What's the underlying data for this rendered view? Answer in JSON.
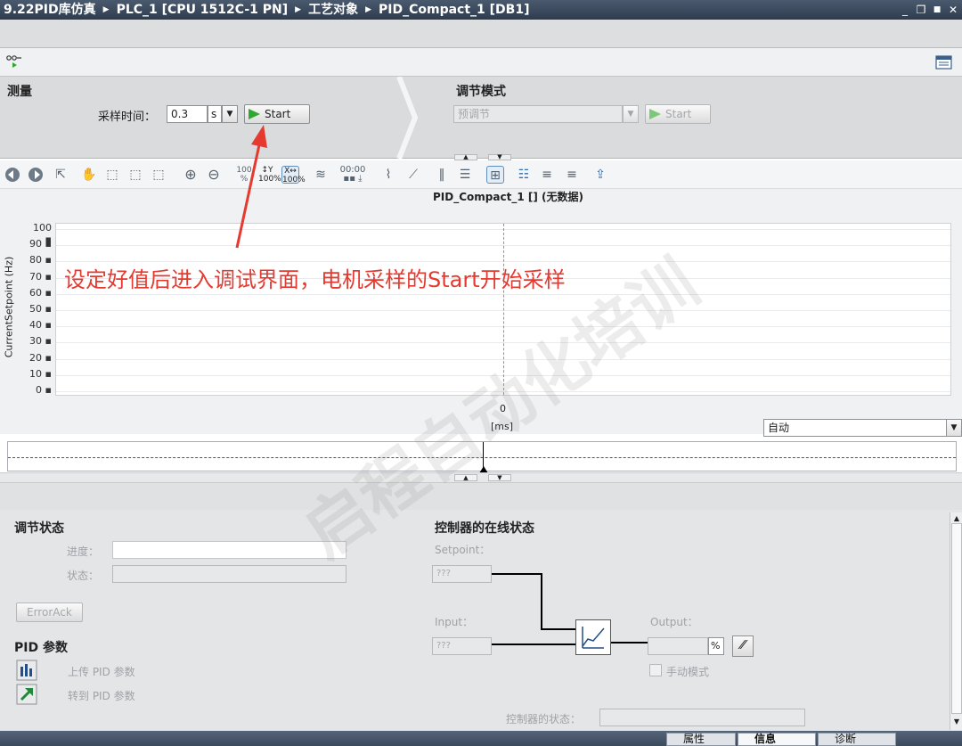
{
  "titlebar": {
    "crumbs": [
      "9.22PID库仿真",
      "PLC_1 [CPU 1512C-1 PN]",
      "工艺对象",
      "PID_Compact_1 [DB1]"
    ],
    "controls": [
      "_",
      "❐",
      "■",
      "✕"
    ]
  },
  "measure": {
    "title": "测量",
    "sampling_label": "采样时间：",
    "sampling_value": "0.3",
    "sampling_unit": "s",
    "start_label": "Start"
  },
  "tuning": {
    "title": "调节模式",
    "mode_value": "预调节",
    "start_label": "Start"
  },
  "chart": {
    "title": "PID_Compact_1 [] (无数据)",
    "ylabel": "CurrentSetpoint (Hz)",
    "x_unit": "[ms]",
    "scale_mode": "自动"
  },
  "chart_data": {
    "type": "line",
    "title": "PID_Compact_1 [] (无数据)",
    "ylabel": "CurrentSetpoint (Hz)",
    "xlabel": "[ms]",
    "ylim": [
      0,
      100
    ],
    "yticks": [
      0,
      10,
      20,
      30,
      40,
      50,
      60,
      70,
      80,
      90,
      100
    ],
    "xticks": [
      0
    ],
    "series": []
  },
  "annotation": {
    "text": "设定好值后进入调试界面，电机采样的Start开始采样",
    "color": "#e53a2f"
  },
  "watermark": "启程自动化培训",
  "tuning_status": {
    "title": "调节状态",
    "progress_label": "进度：",
    "status_label": "状态：",
    "error_ack_label": "ErrorAck"
  },
  "pid_params": {
    "title": "PID 参数",
    "upload_label": "上传 PID 参数",
    "goto_label": "转到 PID 参数"
  },
  "online_status": {
    "title": "控制器的在线状态",
    "setpoint_label": "Setpoint：",
    "setpoint_value": "???",
    "input_label": "Input：",
    "input_value": "???",
    "output_label": "Output：",
    "output_unit": "%",
    "manual_mode_label": "手动模式",
    "controller_state_label": "控制器的状态："
  },
  "statusbar": {
    "tabs": [
      "属性",
      "信息",
      "诊断"
    ]
  }
}
